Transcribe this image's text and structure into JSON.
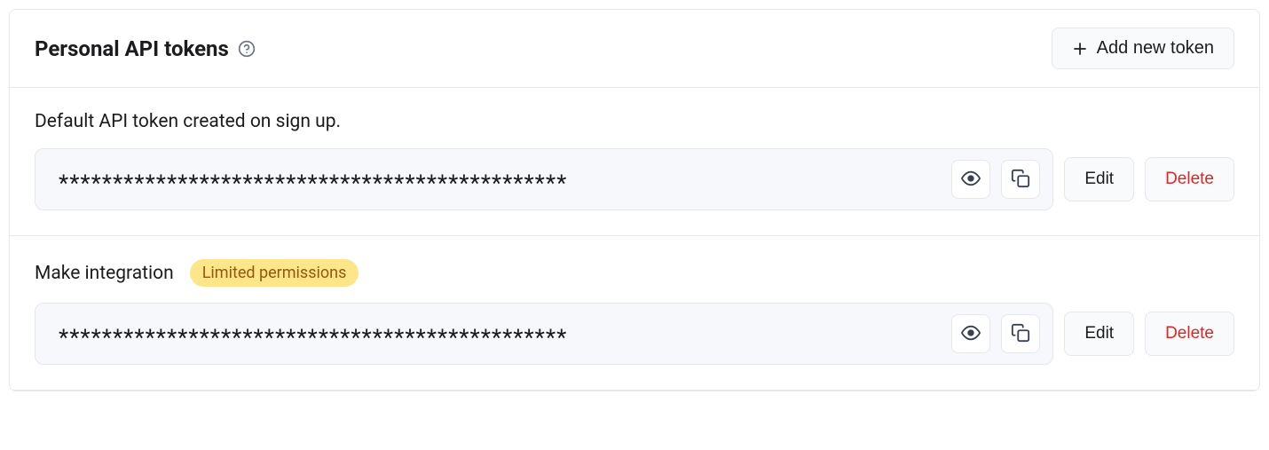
{
  "section": {
    "title": "Personal API tokens",
    "add_button_label": "Add new token"
  },
  "tokens": [
    {
      "label": "Default API token created on sign up.",
      "badge": null,
      "mask": "***********************************************",
      "edit_label": "Edit",
      "delete_label": "Delete"
    },
    {
      "label": "Make integration",
      "badge": "Limited permissions",
      "mask": "***********************************************",
      "edit_label": "Edit",
      "delete_label": "Delete"
    }
  ]
}
